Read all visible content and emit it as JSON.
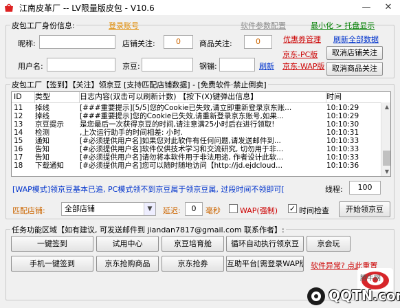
{
  "window": {
    "title": "江南皮革厂 -- LV限量版皮包 - V10.6",
    "minimize_glyph": "—",
    "close_glyph": "✕"
  },
  "identity": {
    "group_title": "皮包工厂身份信息:",
    "login_link": "登录账号",
    "settings_link": "软件参数配置",
    "minimize_tray_link": "最小化 > 托盘显示",
    "coupon_link": "优惠券管理",
    "refresh_link": "刷新全部数据",
    "nickname_label": "昵称:",
    "nickname_value": "",
    "shop_follow_label": "店铺关注:",
    "shop_follow_value": "0",
    "product_follow_label": "商品关注:",
    "product_follow_value": "0",
    "jd_pc_link": "京东-PC版",
    "unfollow_shop_button": "取消店铺关注",
    "username_label": "用户名:",
    "username_value": "",
    "jd_bean_label": "京豆:",
    "jd_bean_value": "",
    "steel_bean_label": "钢镚:",
    "steel_bean_value": "",
    "refresh_small_link": "刷新",
    "jd_wap_link": "京东-WAP版",
    "unfollow_product_button": "取消商品关注"
  },
  "log": {
    "group_title": "皮包工厂【签到】【关注】领京豆 [支持匹配店铺数据] - [免费软件·禁止倒卖]",
    "headers": [
      "ID",
      "类型",
      "日志内容(双击可以刷新计数) 【按下(X)键弹出信息】",
      "时间"
    ],
    "rows": [
      {
        "id": "11",
        "type": "掉线",
        "content": "[###重要提示][5/5]您的Cookie已失效,请立即重新登录京东账...",
        "time": "10:10:29"
      },
      {
        "id": "12",
        "type": "掉线",
        "content": "[###重要提示]您的Cookie已失效,请重新登录京东账号,如果...",
        "time": "10:10:29"
      },
      {
        "id": "13",
        "type": "京豆提示",
        "content": " 是您最后一次获得京豆的时间,请注意满25小时后在进行领取!",
        "time": "10:10:30"
      },
      {
        "id": "14",
        "type": "检测",
        "content": ",上次运行助手的时间相差: 小时.",
        "time": "10:10:31"
      },
      {
        "id": "15",
        "type": "通知",
        "content": "[#必须提供用户名]如果您对此软件有任何问题,请发送邮件到...",
        "time": "10:10:33"
      },
      {
        "id": "16",
        "type": "告知",
        "content": "[#必须提供用户名]软件仅供技术学习和交流研究, 切勿用于非...",
        "time": "10:10:33"
      },
      {
        "id": "17",
        "type": "告知",
        "content": "[#必须提供用户名]请勿将本软件用于非法用途, 作者设计此软...",
        "time": "10:10:33"
      },
      {
        "id": "18",
        "type": "下载通知",
        "content": "[#必须提供用户名]您可以随时随地访问【http://jd.ejdcloud...",
        "time": "10:10:36"
      }
    ],
    "notice": "[WAP模式]领京豆基本已追, PC模式领不到京豆属于领京豆属, 过段时间不领即可[",
    "threads_label": "线程:",
    "threads_value": "100",
    "match_shop_label": "匹配店铺:",
    "shop_select_value": "全部店铺",
    "delay_label": "延迟:",
    "delay_value": "0",
    "ms_label": "毫秒",
    "wap_force_label": "WAP(强制)",
    "time_check_label": "时间检查",
    "start_button": "开始领京豆"
  },
  "tasks": {
    "group_title": "任务功能区域【如有建议, 可发送邮件到 jiandan7817@gmail.com 联系作者】:",
    "buttons": [
      "一键签到",
      "试用中心",
      "京豆培育舱",
      "循环自动执行领京豆",
      "京会玩",
      "手机一键签到",
      "京东抢购商品",
      "京东抢券",
      "互助平台[需登录WAP版]"
    ],
    "error_link": "软件异常? 点此重置"
  },
  "watermark": {
    "site_text": "腾牛网",
    "brand_text": "QQTN.com"
  },
  "colors": {
    "accent_orange": "#cc6600",
    "link_blue": "#0033cc",
    "link_green": "#007f00",
    "link_red": "#cc0000"
  }
}
